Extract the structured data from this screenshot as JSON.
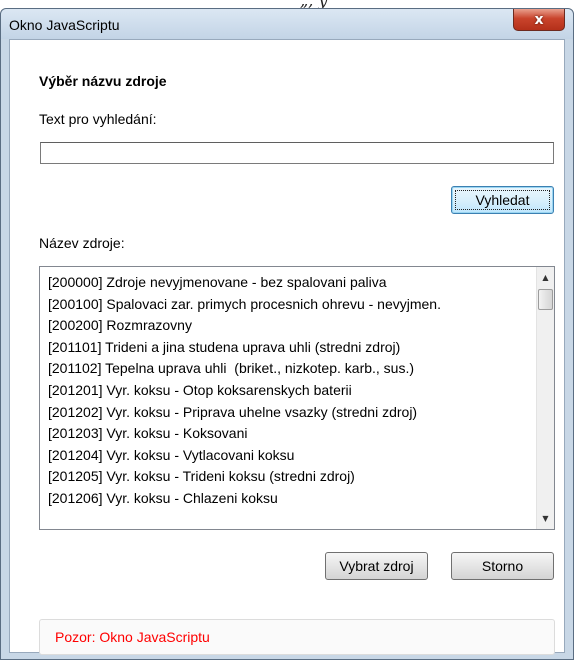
{
  "window": {
    "title": "Okno JavaScriptu",
    "close_label": "x"
  },
  "dialog": {
    "heading": "Výběr názvu zdroje",
    "search_label": "Text pro vyhledání:",
    "search_value": "",
    "search_button": "Vyhledat",
    "list_label": "Název zdroje:",
    "items": [
      "[200000] Zdroje nevyjmenovane - bez spalovani paliva",
      "[200100] Spalovaci zar. primych procesnich ohrevu - nevyjmen.",
      "[200200] Rozmrazovny",
      "[201101] Trideni a jina studena uprava uhli (stredni zdroj)",
      "[201102] Tepelna uprava uhli  (briket., nizkotep. karb., sus.)",
      "[201201] Vyr. koksu - Otop koksarenskych baterii",
      "[201202] Vyr. koksu - Priprava uhelne vsazky (stredni zdroj)",
      "[201203] Vyr. koksu - Koksovani",
      "[201204] Vyr. koksu - Vytlacovani koksu",
      "[201205] Vyr. koksu - Trideni koksu (stredni zdroj)",
      "[201206] Vyr. koksu - Chlazeni koksu"
    ],
    "select_button": "Vybrat zdroj",
    "cancel_button": "Storno",
    "status_text": "Pozor: Okno JavaScriptu"
  },
  "colors": {
    "status_text": "#ff0000",
    "close_button": "#c9442c",
    "frame": "#c8d7e6"
  },
  "icons": {
    "close": "close-icon",
    "scroll_up": "scroll-up-arrow-icon",
    "scroll_down": "scroll-down-arrow-icon"
  }
}
